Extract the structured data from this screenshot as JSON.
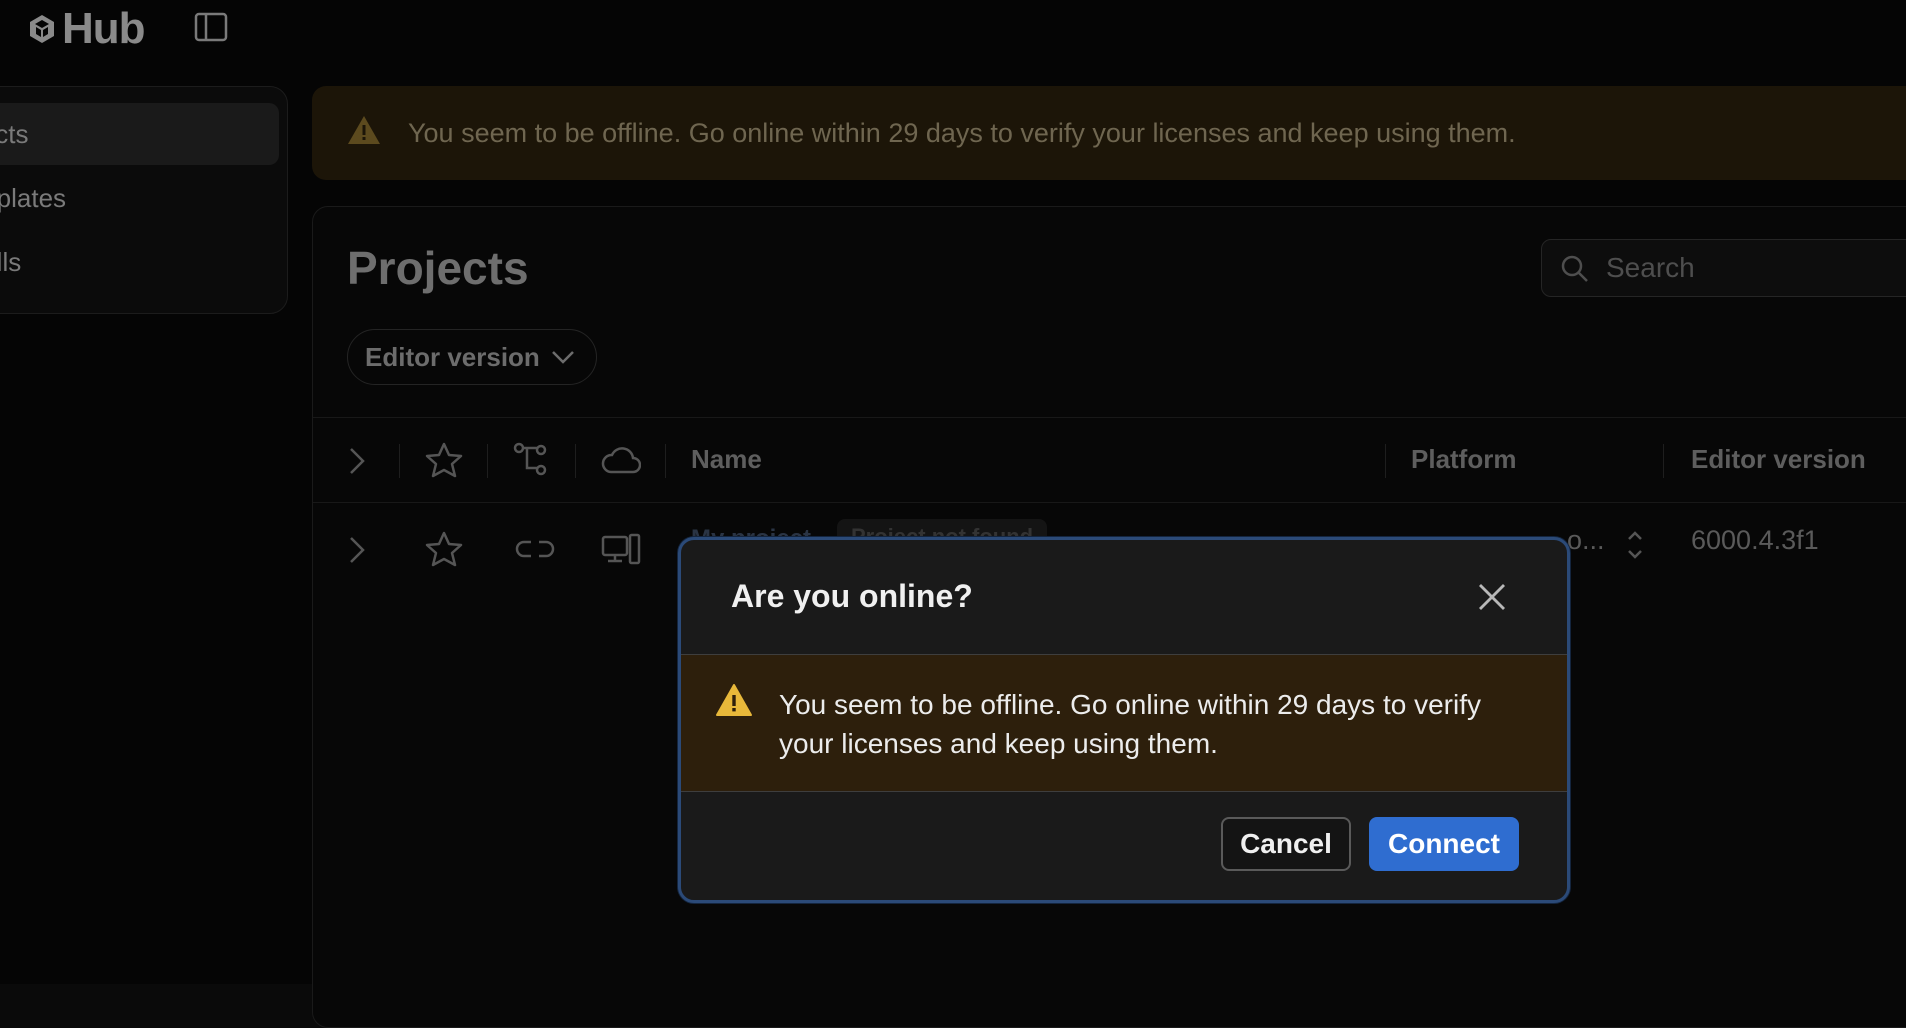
{
  "app": {
    "logo_text": "Hub"
  },
  "sidebar": {
    "items": [
      {
        "label": "Projects",
        "visible": "jects"
      },
      {
        "label": "Templates",
        "visible": "mplates"
      },
      {
        "label": "Installs",
        "visible": "talls"
      }
    ]
  },
  "banner": {
    "text": "You seem to be offline. Go online within 29 days to verify your licenses and keep using them."
  },
  "main": {
    "title": "Projects",
    "search_placeholder": "Search",
    "filter_label": "Editor version",
    "columns": {
      "name": "Name",
      "platform": "Platform",
      "editor_version": "Editor version"
    },
    "rows": [
      {
        "name": "My project",
        "badge": "Project not found",
        "platform_truncated": "o...",
        "editor_version": "6000.4.3f1"
      }
    ]
  },
  "dialog": {
    "title": "Are you online?",
    "message": "You seem to be offline. Go online within 29 days to verify your licenses and keep using them.",
    "cancel_label": "Cancel",
    "connect_label": "Connect"
  },
  "colors": {
    "accent": "#2f6dd0",
    "warning": "#e8b83a",
    "dialog_border": "#2b4a78"
  }
}
